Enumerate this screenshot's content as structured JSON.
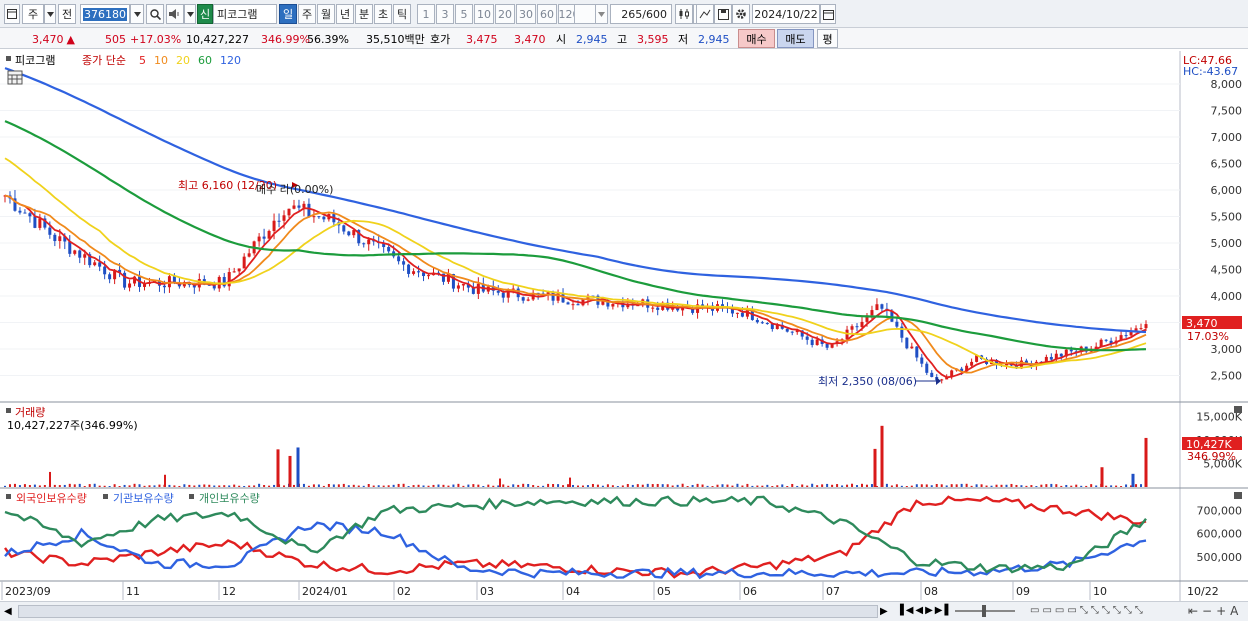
{
  "toolbar": {
    "market": "주",
    "prev_label": "전",
    "code": "376180",
    "tag": "신",
    "name": "피코그램",
    "periods": [
      "일",
      "주",
      "월",
      "년",
      "분",
      "초",
      "틱"
    ],
    "active_period": "일",
    "intervals": [
      "1",
      "3",
      "5",
      "10",
      "20",
      "30",
      "60",
      "120"
    ],
    "count_value": "265",
    "count_max": "/600",
    "date": "2024/10/22"
  },
  "info": {
    "price": "3,470",
    "change_arrow": "▲",
    "change": "505",
    "change_pct": "+17.03%",
    "volume": "10,427,227",
    "volume_ratio": "346.99%",
    "turnover": "56.39%",
    "amount": "35,510백만",
    "quote_label": "호가",
    "ask": "3,475",
    "bid": "3,470",
    "open_label": "시",
    "open": "2,945",
    "high_label": "고",
    "high": "3,595",
    "low_label": "저",
    "low": "2,945",
    "buy_label": "매수",
    "sell_label": "매도",
    "avg_label": "평"
  },
  "price_panel": {
    "legend_name": "피코그램",
    "legend_prefix": "종가 단순",
    "ma": [
      {
        "period": "5",
        "color": "#e02020"
      },
      {
        "period": "10",
        "color": "#f08a1c"
      },
      {
        "period": "20",
        "color": "#f0d21c"
      },
      {
        "period": "60",
        "color": "#1c9c3c"
      },
      {
        "period": "120",
        "color": "#2f62e0"
      }
    ],
    "lc": "LC:47.66",
    "hc": "HC:-43.67",
    "high_label": "최고 6,160 (12/20)",
    "low_label": "최저 2,350 (08/06)",
    "stray_label": "매수 라(0.00%)",
    "current_price": "3,470",
    "current_pct": "17.03%",
    "y_ticks": [
      "8,000",
      "7,500",
      "7,000",
      "6,500",
      "6,000",
      "5,500",
      "5,000",
      "4,500",
      "4,000",
      "3,500",
      "3,000",
      "2,500"
    ]
  },
  "volume_panel": {
    "title": "거래량",
    "summary": "10,427,227주(346.99%)",
    "current_value": "10,427K",
    "current_pct": "346.99%",
    "y_ticks": [
      "15,000K",
      "10,000K",
      "5,000K"
    ]
  },
  "holding_panel": {
    "legend": [
      {
        "label": "외국인보유수량",
        "color": "#e02020"
      },
      {
        "label": "기관보유수량",
        "color": "#2f62e0"
      },
      {
        "label": "개인보유수량",
        "color": "#2e8a5c"
      }
    ],
    "y_ticks": [
      "700,000",
      "600,000",
      "500,000"
    ]
  },
  "x_axis": {
    "labels": [
      "2023/09",
      "11",
      "12",
      "2024/01",
      "02",
      "03",
      "04",
      "05",
      "06",
      "07",
      "08",
      "09",
      "10"
    ],
    "end_label": "10/22"
  },
  "chart_data": [
    {
      "type": "line",
      "title": "",
      "series_type": "candlestick with moving averages",
      "x_range": [
        "2023/09",
        "2024/10/22"
      ],
      "ylim": [
        2000,
        8400
      ],
      "y_ticks": [
        8000,
        7500,
        7000,
        6500,
        6000,
        5500,
        5000,
        4500,
        4000,
        3500,
        3000,
        2500
      ],
      "close_approx": [
        {
          "x": "2023/09",
          "y": 5900
        },
        {
          "x": "2023/10",
          "y": 5100
        },
        {
          "x": "2023/11",
          "y": 4250
        },
        {
          "x": "2023/12",
          "y": 4250
        },
        {
          "x": "2023/12/20",
          "y": 5700
        },
        {
          "x": "2024/01",
          "y": 5400
        },
        {
          "x": "2024/02",
          "y": 4600
        },
        {
          "x": "2024/03",
          "y": 4100
        },
        {
          "x": "2024/04",
          "y": 3950
        },
        {
          "x": "2024/05",
          "y": 3850
        },
        {
          "x": "2024/06",
          "y": 3700
        },
        {
          "x": "2024/07",
          "y": 3000
        },
        {
          "x": "2024/07/20",
          "y": 3800
        },
        {
          "x": "2024/08/06",
          "y": 2350
        },
        {
          "x": "2024/08/20",
          "y": 2800
        },
        {
          "x": "2024/09",
          "y": 2700
        },
        {
          "x": "2024/10",
          "y": 3050
        },
        {
          "x": "2024/10/22",
          "y": 3470
        }
      ],
      "annotations": {
        "high": 6160,
        "high_date": "12/20",
        "low": 2350,
        "low_date": "08/06",
        "last": 3470
      }
    },
    {
      "type": "bar",
      "title": "거래량",
      "unit": "K",
      "ylim": [
        0,
        17000
      ],
      "y_ticks": [
        15000,
        10000,
        5000
      ],
      "notable": [
        {
          "x": "2023/12/20",
          "y": 8000
        },
        {
          "x": "2023/12/22",
          "y": 6600
        },
        {
          "x": "2023/12/26",
          "y": 8400
        },
        {
          "x": "2024/07/19",
          "y": 8100
        },
        {
          "x": "2024/07/22",
          "y": 13000
        },
        {
          "x": "2024/10/01",
          "y": 4200
        },
        {
          "x": "2024/10/18",
          "y": 2800
        },
        {
          "x": "2024/10/22",
          "y": 10427
        }
      ]
    },
    {
      "type": "line",
      "title": "보유수량",
      "ylim": [
        400000,
        780000
      ],
      "y_ticks": [
        700000,
        600000,
        500000
      ],
      "series": [
        {
          "name": "외국인보유수량",
          "values": [
            520000,
            470000,
            520000,
            560000,
            470000,
            440000,
            470000,
            460000,
            440000,
            430000,
            460000,
            510000,
            740000,
            740000,
            700000,
            650000
          ]
        },
        {
          "name": "기관보유수량",
          "values": [
            510000,
            600000,
            470000,
            470000,
            640000,
            610000,
            450000,
            430000,
            430000,
            430000,
            430000,
            430000,
            430000,
            440000,
            470000,
            580000
          ]
        },
        {
          "name": "개인보유수량",
          "values": [
            700000,
            560000,
            660000,
            690000,
            520000,
            700000,
            720000,
            740000,
            740000,
            740000,
            740000,
            650000,
            480000,
            450000,
            460000,
            660000
          ]
        }
      ]
    }
  ]
}
